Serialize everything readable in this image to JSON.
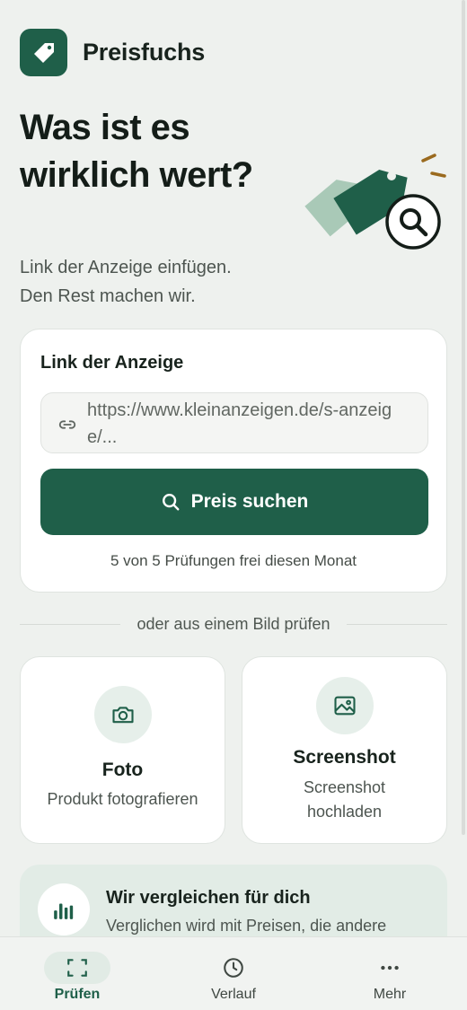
{
  "app": {
    "name": "Preisfuchs"
  },
  "hero": {
    "title": "Was ist es wirklich wert?",
    "subtitle_line1": "Link der Anzeige einfügen.",
    "subtitle_line2": "Den Rest machen wir."
  },
  "link_card": {
    "label": "Link der Anzeige",
    "input_value": "https://www.kleinanzeigen.de/s-anzeige/...",
    "button_label": "Preis suchen",
    "quota_text": "5 von 5 Prüfungen frei diesen Monat"
  },
  "divider_text": "oder aus einem Bild prüfen",
  "options": {
    "foto": {
      "title": "Foto",
      "description": "Produkt fotografieren",
      "icon": "camera-icon"
    },
    "screenshot": {
      "title": "Screenshot",
      "description": "Screenshot hochladen",
      "icon": "image-icon"
    }
  },
  "info": {
    "title": "Wir vergleichen für dich",
    "text": "Verglichen wird mit Preisen, die andere",
    "icon": "bar-chart-icon"
  },
  "nav": {
    "items": [
      {
        "label": "Prüfen",
        "icon": "scan-icon",
        "active": true
      },
      {
        "label": "Verlauf",
        "icon": "clock-icon",
        "active": false
      },
      {
        "label": "Mehr",
        "icon": "more-icon",
        "active": false
      }
    ]
  },
  "colors": {
    "brand": "#1f5f49",
    "background": "#eef1ee",
    "card": "#ffffff",
    "accent_orange": "#9a6a1e"
  }
}
